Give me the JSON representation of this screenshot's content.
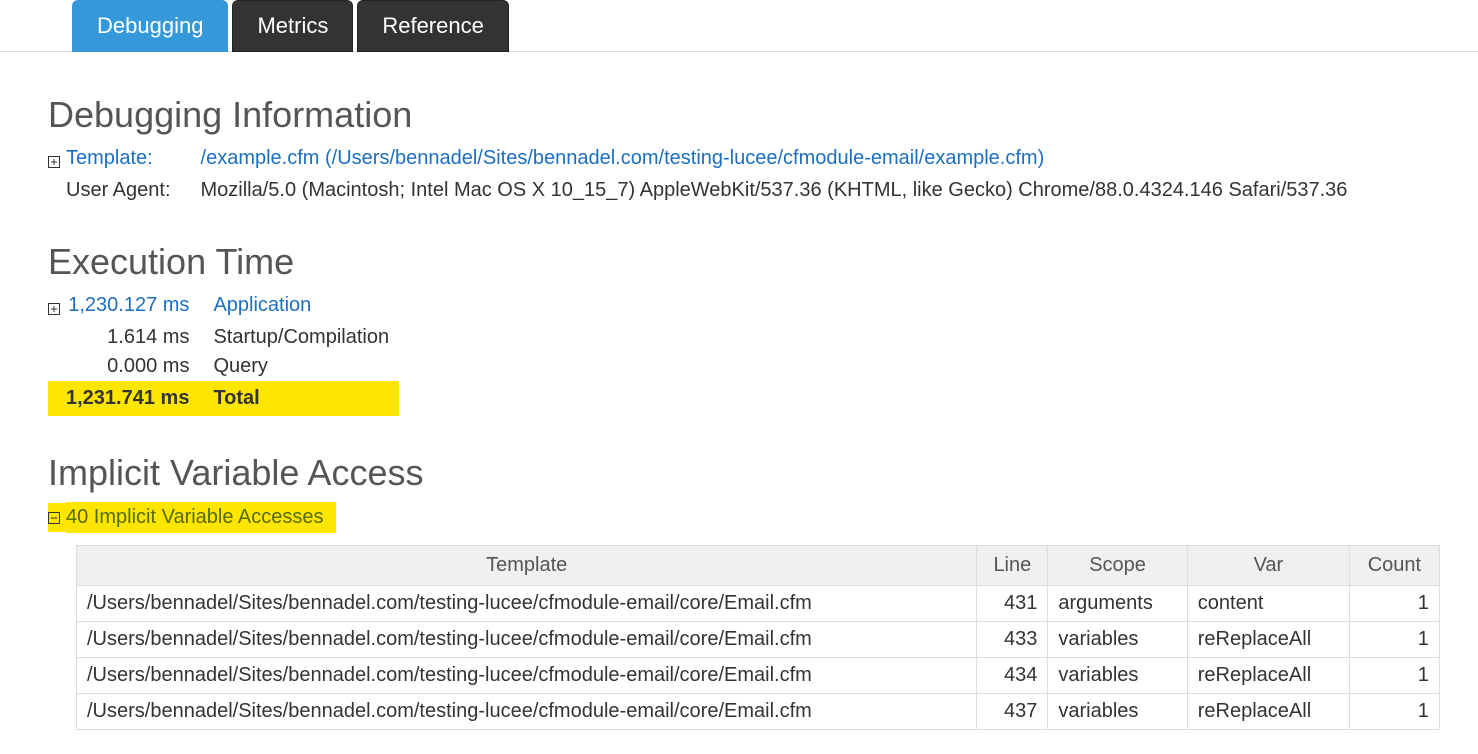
{
  "tabs": [
    {
      "label": "Debugging",
      "active": true
    },
    {
      "label": "Metrics",
      "active": false
    },
    {
      "label": "Reference",
      "active": false
    }
  ],
  "debug_info": {
    "heading": "Debugging Information",
    "template_label": "Template:",
    "template_value": "/example.cfm (/Users/bennadel/Sites/bennadel.com/testing-lucee/cfmodule-email/example.cfm)",
    "ua_label": "User Agent:",
    "ua_value": "Mozilla/5.0 (Macintosh; Intel Mac OS X 10_15_7) AppleWebKit/537.36 (KHTML, like Gecko) Chrome/88.0.4324.146 Safari/537.36"
  },
  "exec_time": {
    "heading": "Execution Time",
    "rows": [
      {
        "time": "1,230.127 ms",
        "label": "Application",
        "link": true,
        "expand": true
      },
      {
        "time": "1.614 ms",
        "label": "Startup/Compilation",
        "link": false
      },
      {
        "time": "0.000 ms",
        "label": "Query",
        "link": false
      }
    ],
    "total_time": "1,231.741 ms",
    "total_label": "Total"
  },
  "implicit": {
    "heading": "Implicit Variable Access",
    "summary": "40 Implicit Variable Accesses",
    "columns": [
      "Template",
      "Line",
      "Scope",
      "Var",
      "Count"
    ],
    "rows": [
      {
        "template": "/Users/bennadel/Sites/bennadel.com/testing-lucee/cfmodule-email/core/Email.cfm",
        "line": "431",
        "scope": "arguments",
        "var": "content",
        "count": "1"
      },
      {
        "template": "/Users/bennadel/Sites/bennadel.com/testing-lucee/cfmodule-email/core/Email.cfm",
        "line": "433",
        "scope": "variables",
        "var": "reReplaceAll",
        "count": "1"
      },
      {
        "template": "/Users/bennadel/Sites/bennadel.com/testing-lucee/cfmodule-email/core/Email.cfm",
        "line": "434",
        "scope": "variables",
        "var": "reReplaceAll",
        "count": "1"
      },
      {
        "template": "/Users/bennadel/Sites/bennadel.com/testing-lucee/cfmodule-email/core/Email.cfm",
        "line": "437",
        "scope": "variables",
        "var": "reReplaceAll",
        "count": "1"
      }
    ]
  }
}
